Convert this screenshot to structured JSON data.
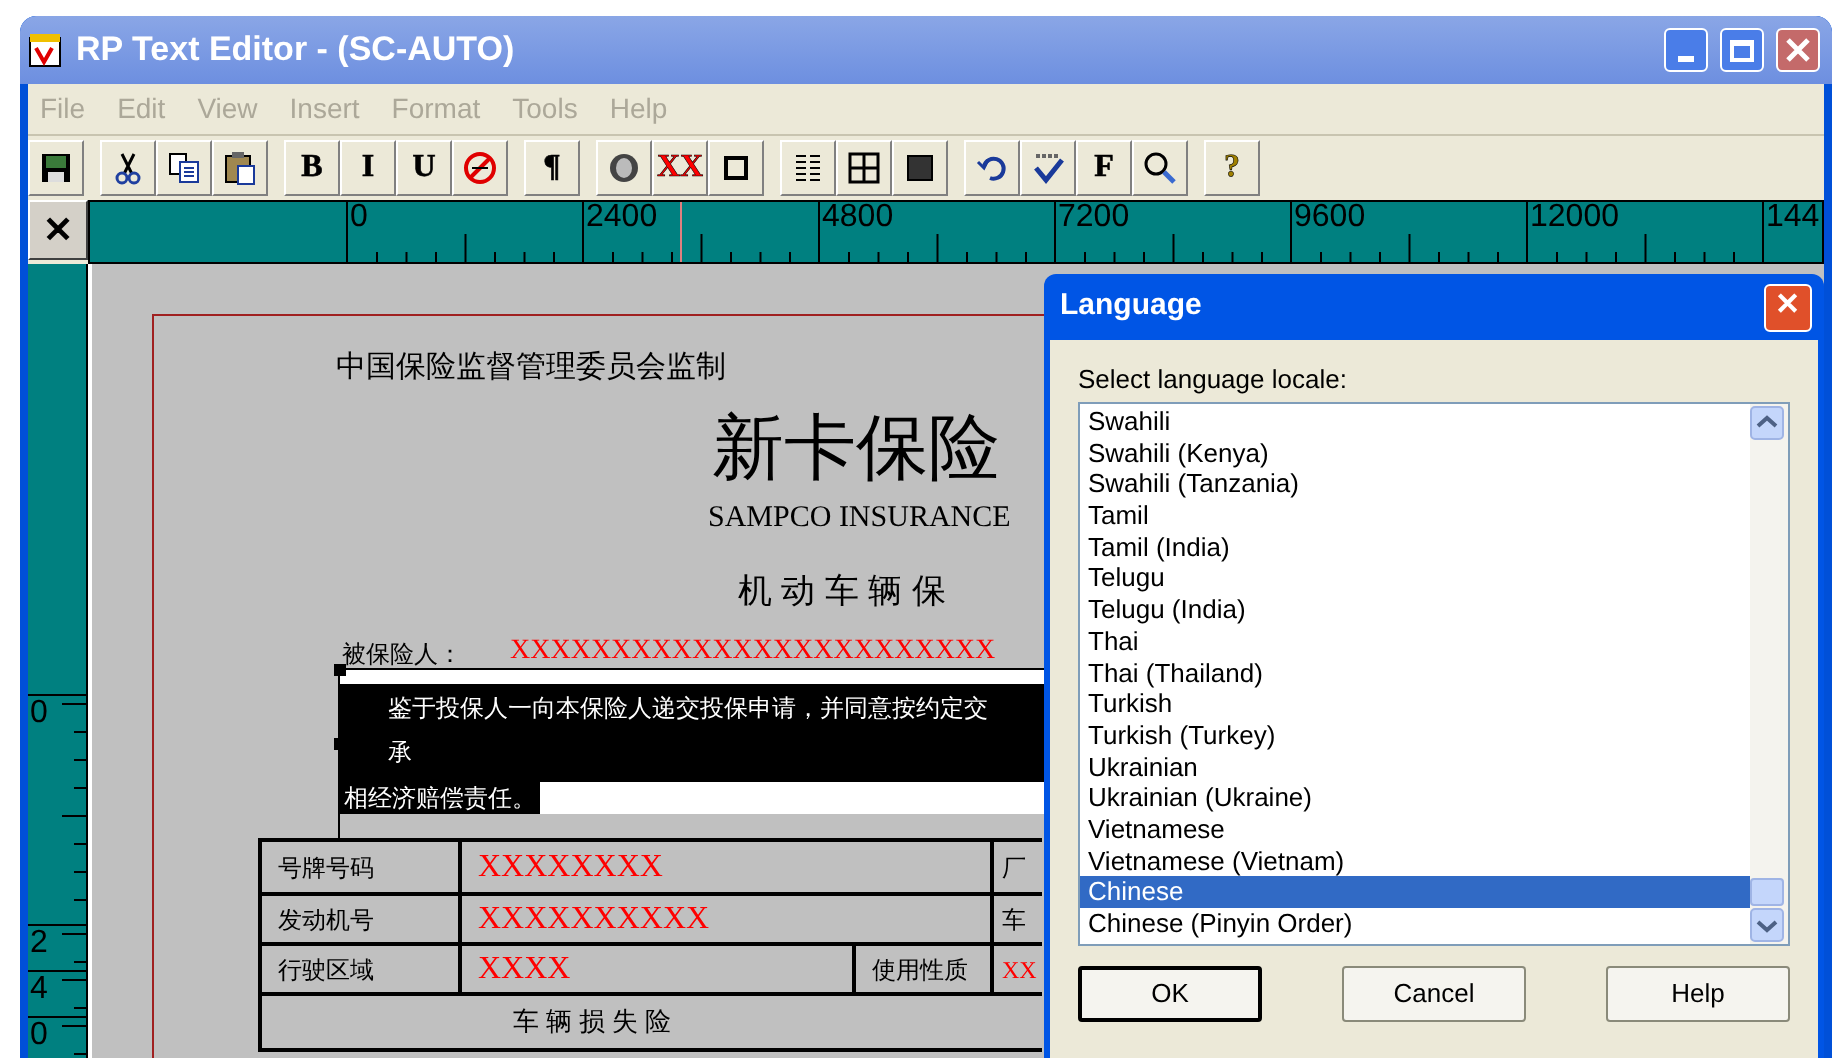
{
  "window": {
    "title": "RP Text Editor - (SC-AUTO)"
  },
  "menu": [
    {
      "label": "File",
      "disabled": true
    },
    {
      "label": "Edit",
      "disabled": true
    },
    {
      "label": "View",
      "disabled": true
    },
    {
      "label": "Insert",
      "disabled": true
    },
    {
      "label": "Format",
      "disabled": true
    },
    {
      "label": "Tools",
      "disabled": true
    },
    {
      "label": "Help",
      "disabled": true
    }
  ],
  "toolbar": [
    [
      {
        "kind": "icon"
      }
    ],
    [
      {
        "kind": "icon"
      },
      {
        "kind": "icon"
      },
      {
        "kind": "icon"
      }
    ],
    [
      {
        "kind": "text",
        "label": "B",
        "color": "#000000"
      },
      {
        "kind": "text",
        "label": "I",
        "color": "#000000"
      },
      {
        "kind": "text",
        "label": "U",
        "color": "#000000"
      },
      {
        "kind": "icon"
      }
    ],
    [
      {
        "kind": "text",
        "label": "¶",
        "color": "#000000"
      }
    ],
    [
      {
        "kind": "icon"
      },
      {
        "kind": "text",
        "label": "XX",
        "color": "#ff0000"
      },
      {
        "kind": "icon"
      }
    ],
    [
      {
        "kind": "icon"
      },
      {
        "kind": "icon"
      },
      {
        "kind": "icon"
      }
    ],
    [
      {
        "kind": "icon"
      },
      {
        "kind": "icon"
      },
      {
        "kind": "text",
        "label": "F",
        "color": "#000000"
      },
      {
        "kind": "icon"
      }
    ],
    [
      {
        "kind": "text",
        "label": "?",
        "color": "#a08000"
      }
    ]
  ],
  "ruler": {
    "close": "✕",
    "labels": [
      "0",
      "2400",
      "4800",
      "7200",
      "9600",
      "12000",
      "144"
    ]
  },
  "vertical_ruler": {
    "labels": [
      "0",
      "2",
      "4",
      "0"
    ]
  },
  "document": {
    "subtitle": "中国保险监督管理委员会监制",
    "title": "新卡保险",
    "english_title": "SAMPCO INSURANCE",
    "heading": "机 动 车 辆 保",
    "insured_label": "被保险人：",
    "insured_value": "XXXXXXXXXXXXXXXXXXXXXXXX",
    "clause_lines": [
      "鉴于投保人一向本保险人递交投保申请，并同意按约定交",
      "承",
      "相经济赔偿责任。"
    ],
    "table": {
      "rows": [
        [
          "号牌号码",
          "XXXXXXXX",
          "厂"
        ],
        [
          "发动机号",
          "XXXXXXXXXX",
          "车"
        ],
        [
          "行驶区域",
          "XXXX",
          "使用性质",
          "XX"
        ]
      ],
      "section": "车 辆 损 失 险"
    }
  },
  "dialog": {
    "title": "Language",
    "close": "✕",
    "prompt": "Select language locale:",
    "items": [
      {
        "label": "Swahili",
        "selected": false
      },
      {
        "label": "Swahili (Kenya)",
        "selected": false
      },
      {
        "label": "Swahili (Tanzania)",
        "selected": false
      },
      {
        "label": "Tamil",
        "selected": false
      },
      {
        "label": "Tamil (India)",
        "selected": false
      },
      {
        "label": "Telugu",
        "selected": false
      },
      {
        "label": "Telugu (India)",
        "selected": false
      },
      {
        "label": "Thai",
        "selected": false
      },
      {
        "label": "Thai (Thailand)",
        "selected": false
      },
      {
        "label": "Turkish",
        "selected": false
      },
      {
        "label": "Turkish (Turkey)",
        "selected": false
      },
      {
        "label": "Ukrainian",
        "selected": false
      },
      {
        "label": "Ukrainian (Ukraine)",
        "selected": false
      },
      {
        "label": "Vietnamese",
        "selected": false
      },
      {
        "label": "Vietnamese (Vietnam)",
        "selected": false
      },
      {
        "label": "Chinese",
        "selected": true
      },
      {
        "label": "Chinese (Pinyin Order)",
        "selected": false
      }
    ],
    "buttons": [
      {
        "label": "OK",
        "default": true
      },
      {
        "label": "Cancel",
        "default": false
      },
      {
        "label": "Help",
        "default": false
      }
    ]
  }
}
